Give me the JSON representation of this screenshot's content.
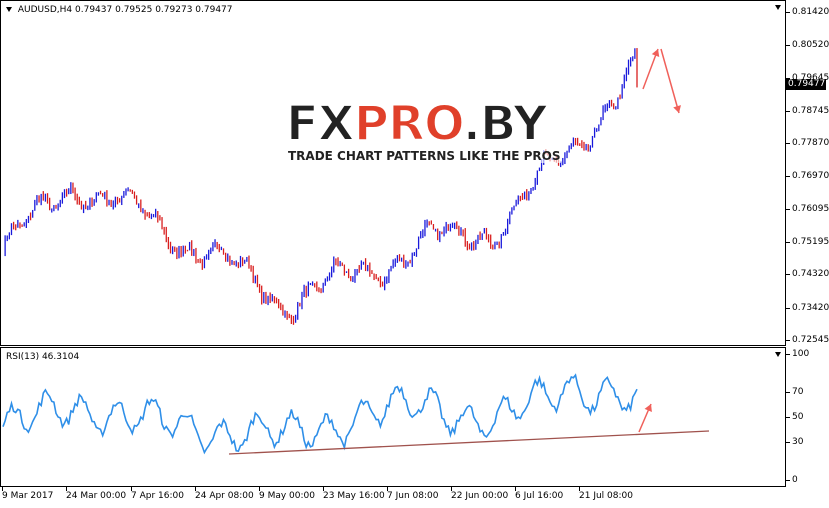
{
  "symbol_header": {
    "symbol": "AUDUSD,H4",
    "open": "0.79437",
    "high": "0.79525",
    "low": "0.79273",
    "close": "0.79477"
  },
  "current_price": "0.79477",
  "price_axis": [
    "0.81420",
    "0.80520",
    "0.79645",
    "0.78745",
    "0.77870",
    "0.76970",
    "0.76095",
    "0.75195",
    "0.74320",
    "0.73420",
    "0.72545"
  ],
  "rsi_header": "RSI(13) 46.3104",
  "rsi_axis": [
    "100",
    "70",
    "50",
    "30",
    "0"
  ],
  "time_axis": [
    "9 Mar 2017",
    "24 Mar 00:00",
    "7 Apr 16:00",
    "24 Apr 08:00",
    "9 May 00:00",
    "23 May 16:00",
    "7 Jun 08:00",
    "22 Jun 00:00",
    "6 Jul 16:00",
    "21 Jul 08:00"
  ],
  "watermark": {
    "title_part1": "FX",
    "title_part2": "PRO",
    "title_part3": ".BY",
    "subtitle": "TRADE CHART PATTERNS LIKE THE PROS"
  },
  "colors": {
    "bull": "#1a1adb",
    "bear": "#d81e1e",
    "rsi": "#2f8fe8",
    "trendline": "#a0524d",
    "arrow": "#f0605a"
  },
  "chart_data": [
    {
      "type": "candlestick",
      "title": "AUDUSD,H4",
      "ylim": [
        0.72545,
        0.8142
      ],
      "x": [
        "9 Mar 2017",
        "24 Mar 00:00",
        "7 Apr 16:00",
        "24 Apr 08:00",
        "9 May 00:00",
        "23 May 16:00",
        "7 Jun 08:00",
        "22 Jun 00:00",
        "6 Jul 16:00",
        "21 Jul 08:00"
      ],
      "series": [
        {
          "values": [
            0.75,
            0.768,
            0.759,
            0.748,
            0.736,
            0.743,
            0.752,
            0.756,
            0.776,
            0.799
          ]
        }
      ]
    },
    {
      "type": "line",
      "title": "RSI(13) 46.3104",
      "ylim": [
        0,
        100
      ],
      "x": [
        "9 Mar 2017",
        "24 Mar 00:00",
        "7 Apr 16:00",
        "24 Apr 08:00",
        "9 May 00:00",
        "23 May 16:00",
        "7 Jun 08:00",
        "22 Jun 00:00",
        "6 Jul 16:00",
        "21 Jul 08:00"
      ],
      "series": [
        {
          "values": [
            42,
            60,
            48,
            40,
            36,
            50,
            62,
            45,
            78,
            60
          ]
        }
      ]
    }
  ]
}
